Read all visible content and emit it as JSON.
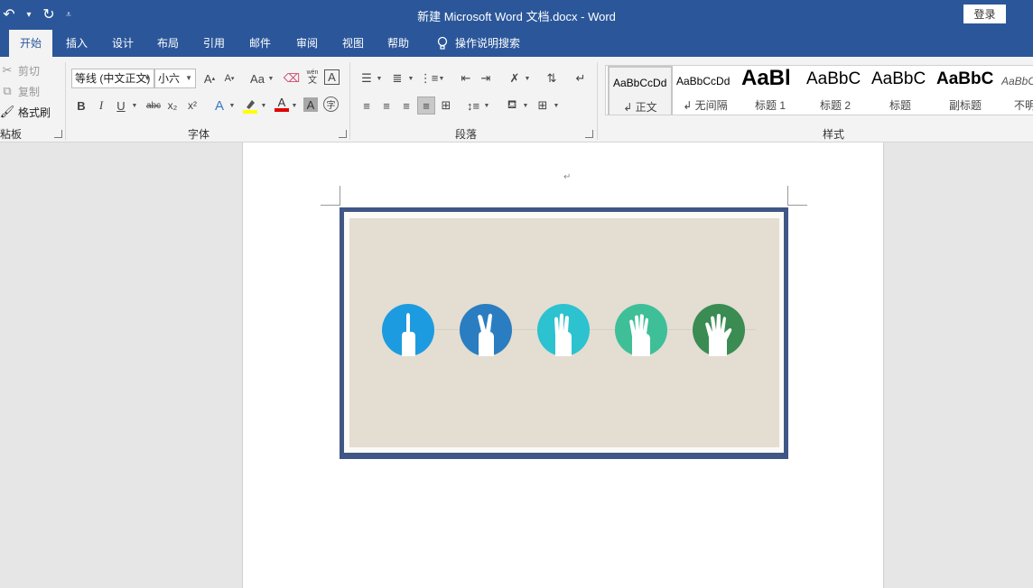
{
  "titlebar": {
    "title": "新建 Microsoft Word 文档.docx  -  Word",
    "login_label": "登录"
  },
  "tabs": [
    {
      "label": "开始",
      "active": true
    },
    {
      "label": "插入"
    },
    {
      "label": "设计"
    },
    {
      "label": "布局"
    },
    {
      "label": "引用"
    },
    {
      "label": "邮件"
    },
    {
      "label": "审阅"
    },
    {
      "label": "视图"
    },
    {
      "label": "帮助"
    },
    {
      "label": "操作说明搜索"
    }
  ],
  "clipboard": {
    "cut": "剪切",
    "copy": "复制",
    "format_painter": "格式刷",
    "group_label": "粘板"
  },
  "font": {
    "font_name": "等线 (中文正文)",
    "font_size": "小六",
    "group_label": "字体",
    "phonetic_top": "wén",
    "phonetic_char": "文",
    "border_char": "A",
    "grow": "A",
    "shrink": "A",
    "case": "Aa",
    "bold": "B",
    "italic": "I",
    "underline": "U",
    "strike": "abc",
    "subscript": "x₂",
    "superscript": "x²",
    "effects": "A",
    "color_letter": "A",
    "shading_letter": "A",
    "encircle": "字"
  },
  "paragraph": {
    "group_label": "段落"
  },
  "styles": {
    "group_label": "样式",
    "items": [
      {
        "sample": "AaBbCcDd",
        "name": "↲ 正文",
        "selected": true
      },
      {
        "sample": "AaBbCcDd",
        "name": "↲ 无间隔"
      },
      {
        "sample": "AaBl",
        "name": "标题 1"
      },
      {
        "sample": "AaBbC",
        "name": "标题 2"
      },
      {
        "sample": "AaBbC",
        "name": "标题"
      },
      {
        "sample": "AaBbC",
        "name": "副标题"
      },
      {
        "sample": "AaBbCcDd",
        "name": "不明显"
      }
    ]
  },
  "document": {
    "paragraph_mark": "↵",
    "fingers": [
      {
        "count": 1,
        "color": "#1d9be0"
      },
      {
        "count": 2,
        "color": "#2a7dc0"
      },
      {
        "count": 3,
        "color": "#2cc2cf"
      },
      {
        "count": 4,
        "color": "#3fbf98"
      },
      {
        "count": 5,
        "color": "#3a8c52"
      }
    ]
  },
  "colors": {
    "word_blue": "#2b579a",
    "frame": "#3f5686",
    "paper": "#e3ddd2"
  }
}
